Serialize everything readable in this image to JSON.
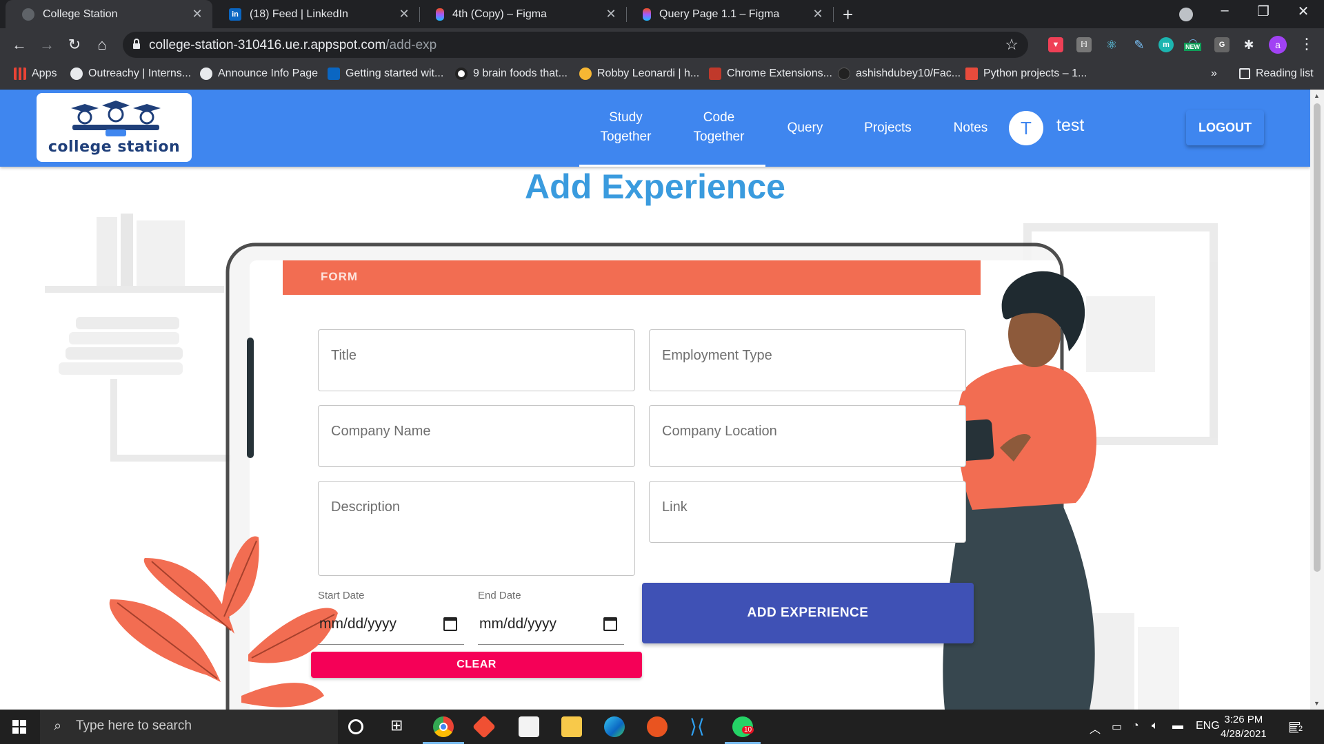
{
  "browser": {
    "tabs": [
      {
        "title": "College Station",
        "icon": "globe-icon",
        "active": true
      },
      {
        "title": "(18) Feed | LinkedIn",
        "icon": "linkedin-icon"
      },
      {
        "title": "4th (Copy) – Figma",
        "icon": "figma-icon"
      },
      {
        "title": "Query Page 1.1 – Figma",
        "icon": "figma-icon"
      }
    ],
    "url_host": "college-station-310416.ue.r.appspot.com",
    "url_path": "/add-exp",
    "extension_badge": "NEW",
    "profile_initial": "a",
    "bookmarks": [
      "Apps",
      "Outreachy | Interns...",
      "Announce Info Page",
      "Getting started wit...",
      "9 brain foods that...",
      "Robby Leonardi | h...",
      "Chrome Extensions...",
      "ashishdubey10/Fac...",
      "Python projects – 1..."
    ],
    "bookmarks_overflow": "»",
    "reading_list": "Reading list"
  },
  "app": {
    "logo_text": "college station",
    "nav": [
      {
        "label": "Study Together"
      },
      {
        "label": "Code Together"
      },
      {
        "label": "Query"
      },
      {
        "label": "Projects"
      },
      {
        "label": "Notes"
      }
    ],
    "user_initial": "T",
    "username": "test",
    "logout": "LOGOUT"
  },
  "page": {
    "title": "Add Experience",
    "illustration_header": "FORM",
    "fields": {
      "title": "Title",
      "employment_type": "Employment Type",
      "company_name": "Company Name",
      "company_location": "Company Location",
      "description": "Description",
      "link": "Link"
    },
    "start_date_label": "Start Date",
    "start_date_value": "mm/dd/yyyy",
    "end_date_label": "End Date",
    "end_date_value": "mm/dd/yyyy",
    "submit": "ADD EXPERIENCE",
    "clear": "CLEAR"
  },
  "taskbar": {
    "search_placeholder": "Type here to search",
    "language": "ENG",
    "time": "3:26 PM",
    "date": "4/28/2021",
    "whatsapp_badge": "10",
    "notification_count": "2"
  },
  "colors": {
    "appbar": "#3f86ef",
    "title": "#3a9bde",
    "submit": "#3f51b5",
    "clear": "#f50057",
    "illustration_accent": "#f26d52"
  }
}
